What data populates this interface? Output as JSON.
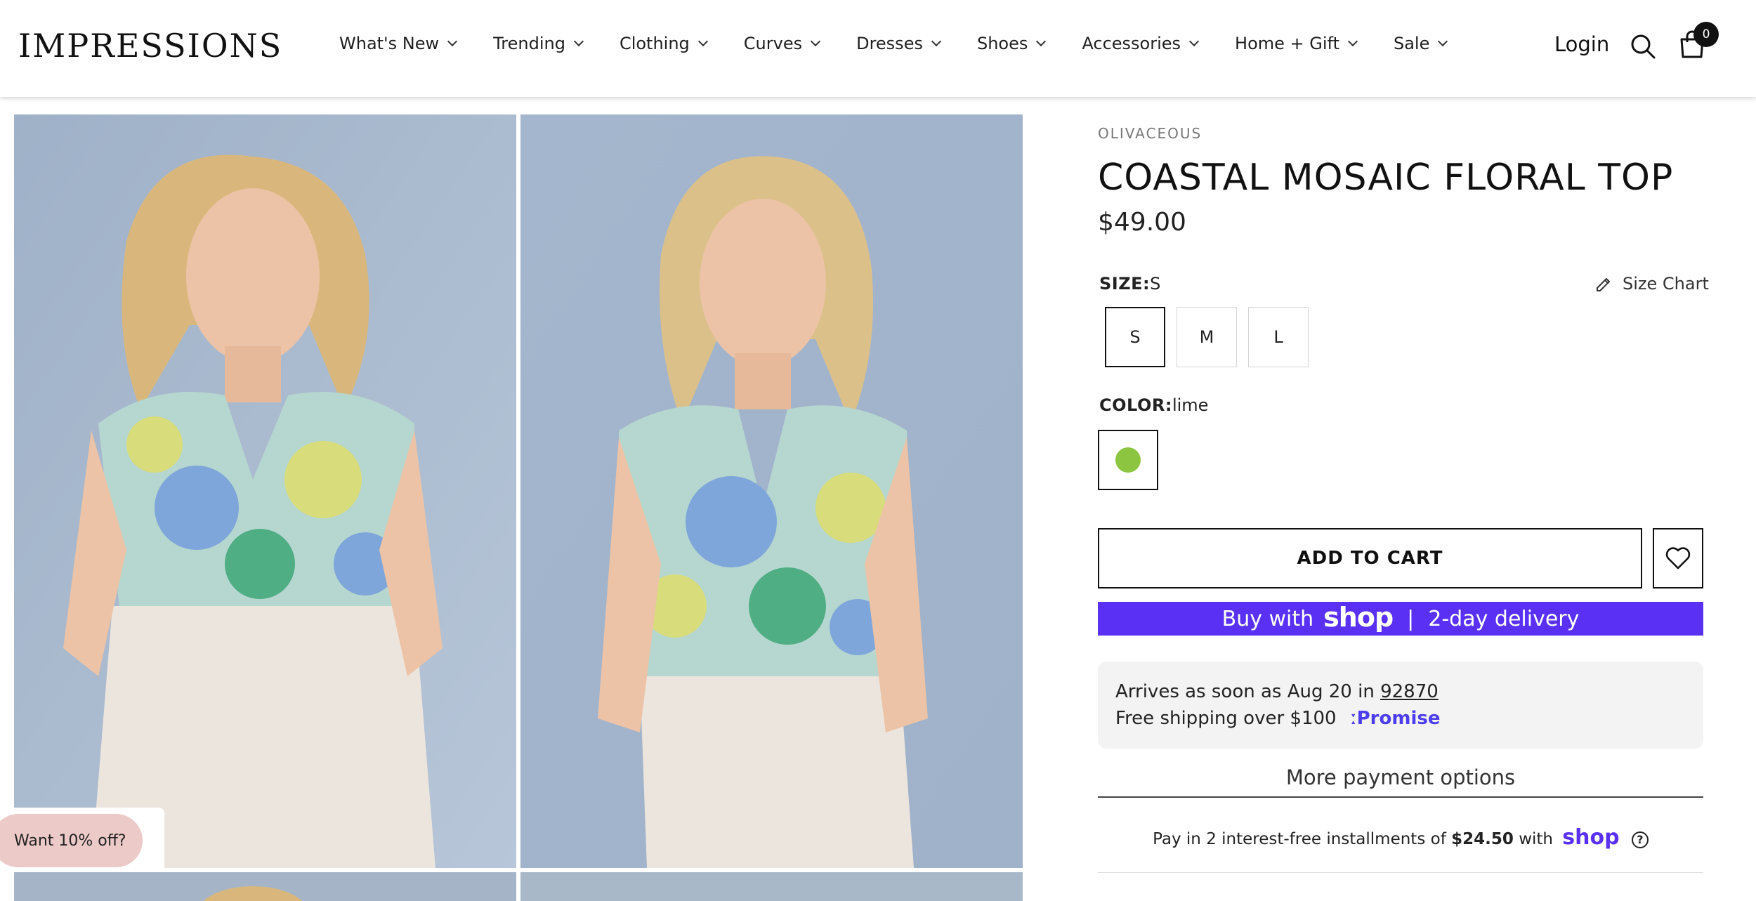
{
  "header": {
    "logo": "IMPRESSIONS",
    "nav": [
      {
        "label": "What's New"
      },
      {
        "label": "Trending"
      },
      {
        "label": "Clothing"
      },
      {
        "label": "Curves"
      },
      {
        "label": "Dresses"
      },
      {
        "label": "Shoes"
      },
      {
        "label": "Accessories"
      },
      {
        "label": "Home + Gift"
      },
      {
        "label": "Sale"
      }
    ],
    "login": "Login",
    "cart_count": "0"
  },
  "promo": {
    "label": "Want 10% off?"
  },
  "product": {
    "vendor": "OLIVACEOUS",
    "title": "COASTAL MOSAIC FLORAL TOP",
    "price": "$49.00",
    "size_label": "SIZE:",
    "size_value": "S",
    "size_chart": "Size Chart",
    "sizes": [
      "S",
      "M",
      "L"
    ],
    "color_label": "COLOR:",
    "color_value": "lime",
    "swatch_color": "#8cc540",
    "add_to_cart": "ADD TO CART"
  },
  "shop_pay": {
    "prefix": "Buy with",
    "brand": "shop",
    "separator": "|",
    "suffix": "2-day delivery",
    "color": "#5a31f4"
  },
  "delivery": {
    "arrives_prefix": "Arrives as soon as Aug 20 in",
    "zip": "92870",
    "free_shipping": "Free shipping over $100",
    "promise": "Promise"
  },
  "payment": {
    "more_options": "More payment options",
    "installments_prefix": "Pay in 2 interest-free installments of",
    "installments_amount": "$24.50",
    "installments_with": "with",
    "brand": "shop"
  }
}
